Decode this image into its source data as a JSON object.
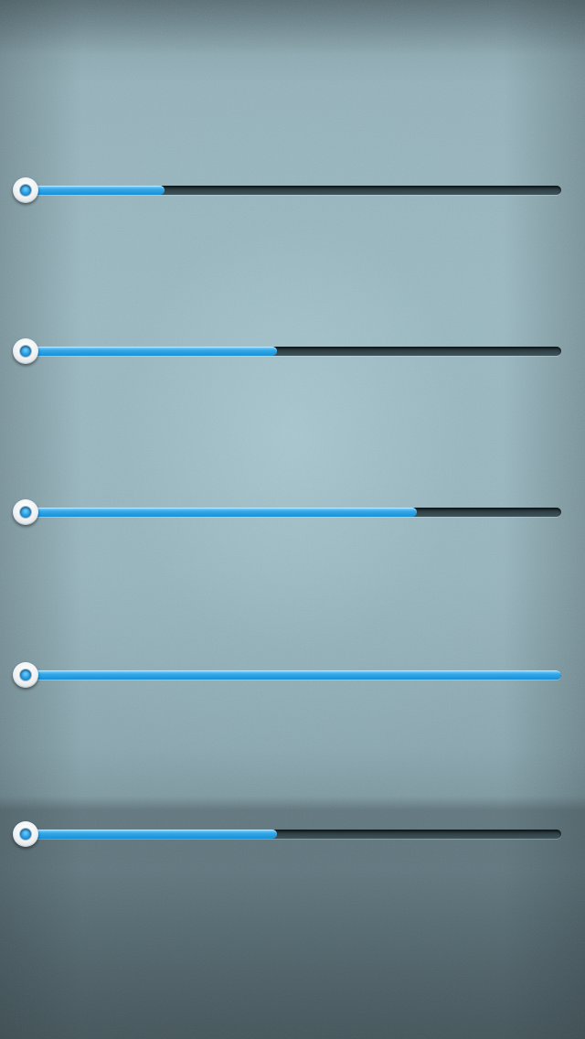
{
  "screen": {
    "accent_color": "#2aa3e6",
    "track_color": "#2c3b40",
    "knob_color": "#f2f5f7"
  },
  "sliders": [
    {
      "value": 0.26
    },
    {
      "value": 0.47
    },
    {
      "value": 0.73
    },
    {
      "value": 1.0
    },
    {
      "value": 0.47
    }
  ]
}
